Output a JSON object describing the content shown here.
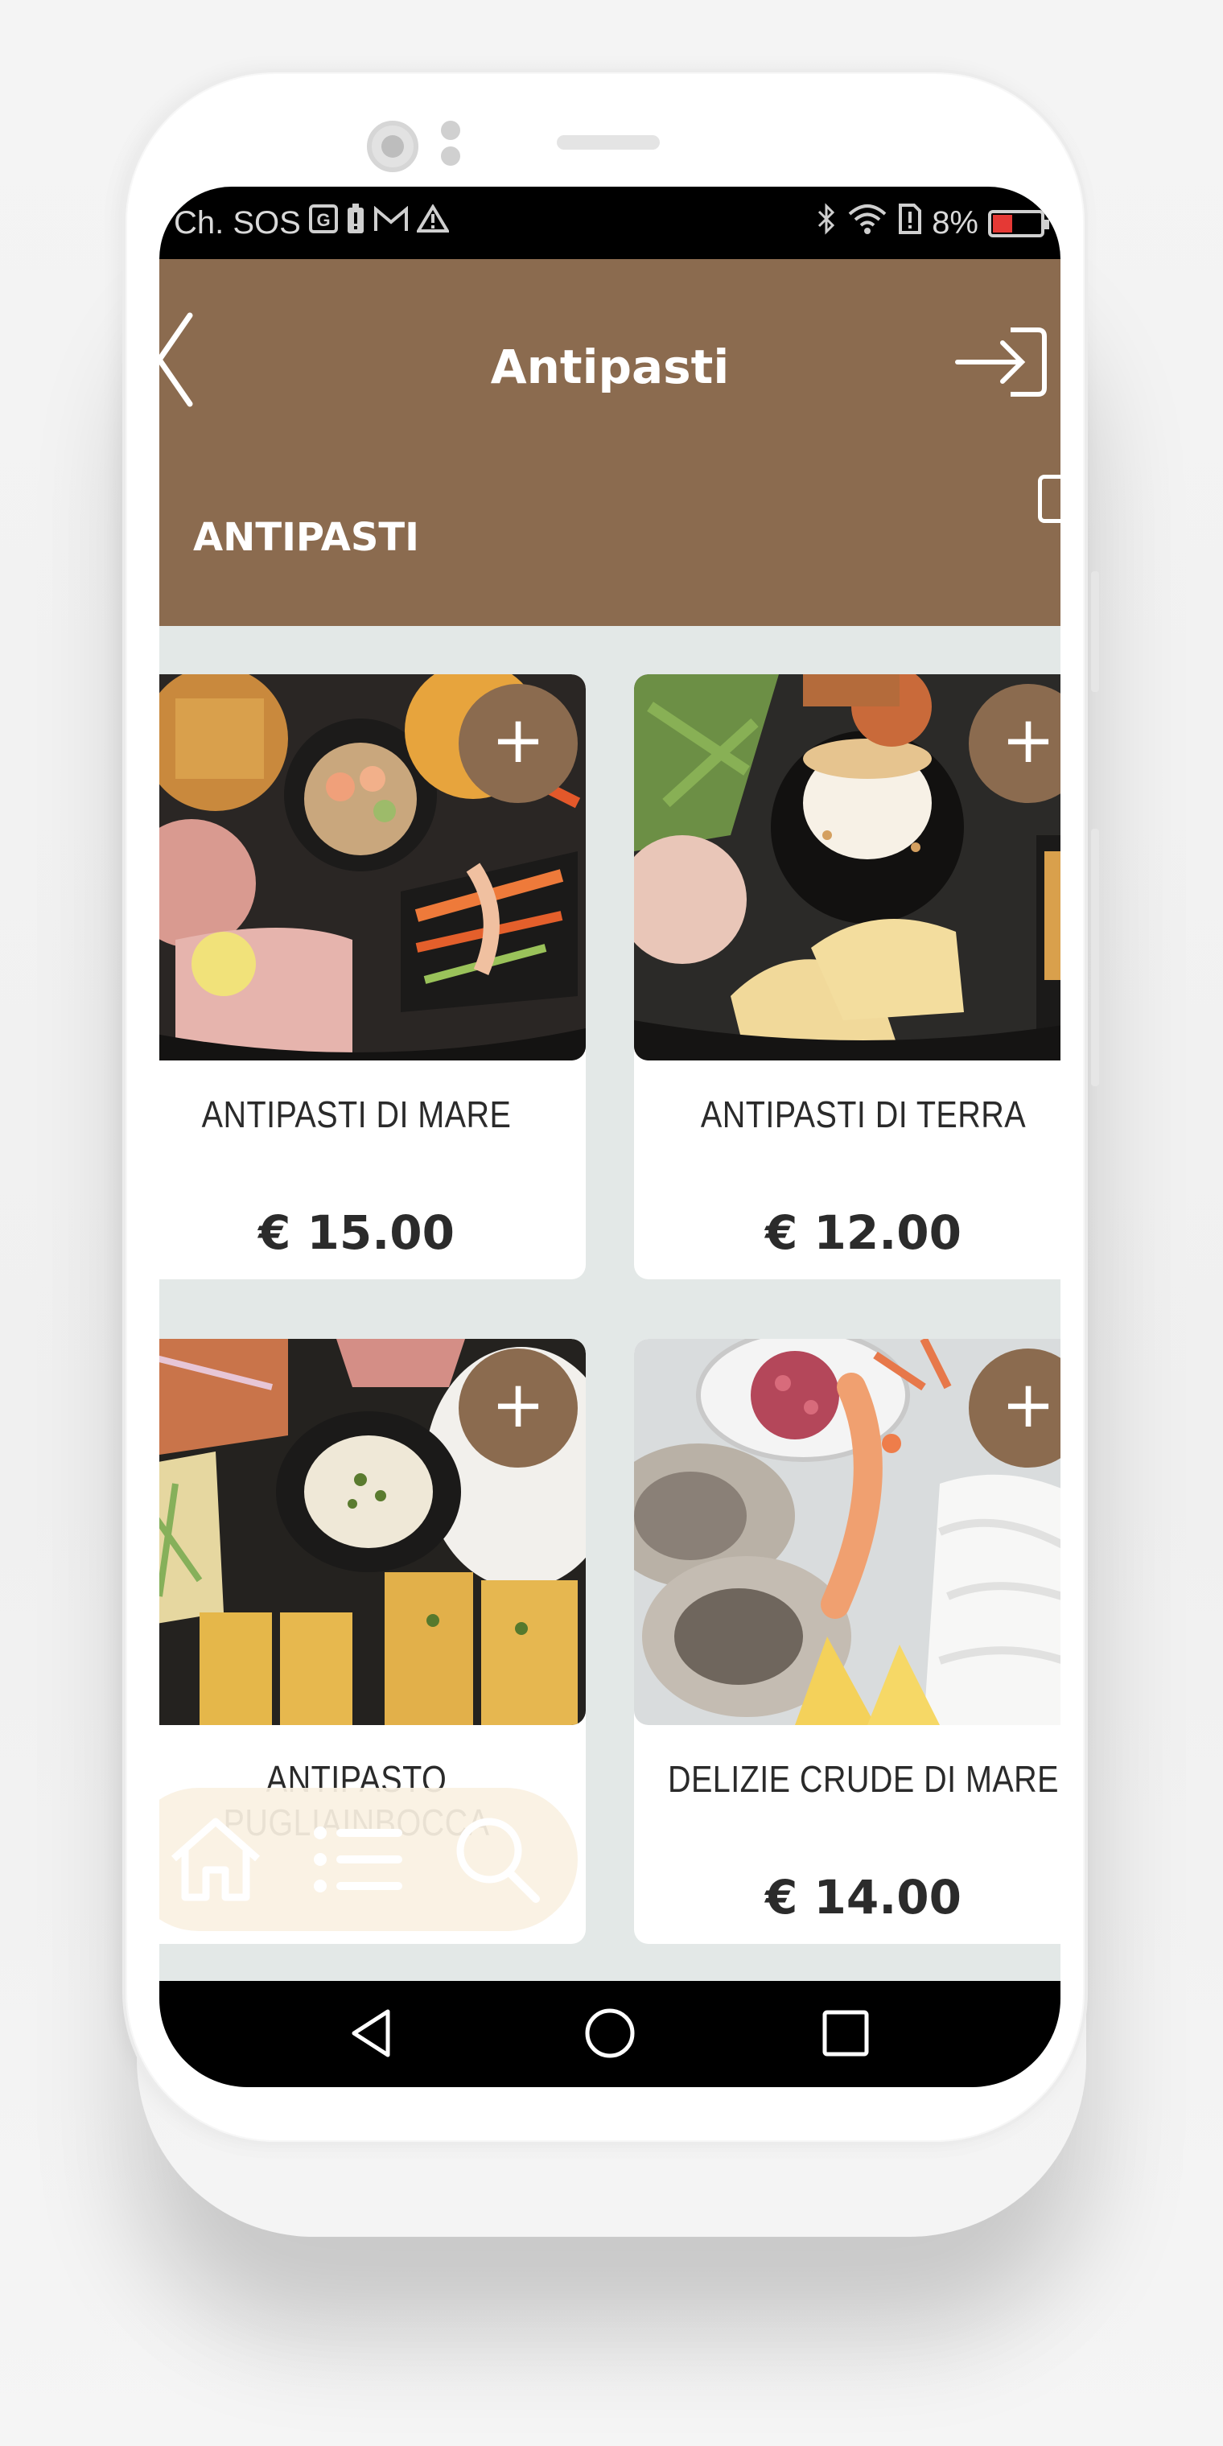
{
  "status_bar": {
    "left_text": "Ch. SOS",
    "battery_percent": "8%",
    "icons_left": [
      "google-icon",
      "battery-alert-icon",
      "gmail-icon",
      "warning-icon"
    ],
    "icons_right": [
      "bluetooth-icon",
      "wifi-icon",
      "sim-alert-icon",
      "battery-icon"
    ]
  },
  "app_bar": {
    "title": "Antipasti",
    "back_icon": "chevron-left-icon",
    "login_icon": "login-icon",
    "color": "#8b6b4f"
  },
  "tabs": [
    {
      "label": "ANTIPASTI",
      "active": true
    }
  ],
  "products": [
    {
      "name": "ANTIPASTI DI MARE",
      "price": "€ 15.00",
      "image": "seafood-platter"
    },
    {
      "name": "ANTIPASTI DI TERRA",
      "price": "€ 12.00",
      "image": "cold-cuts-platter"
    },
    {
      "name": "ANTIPASTO PUGLIAINBOCCA",
      "price": "",
      "image": "puglia-platter"
    },
    {
      "name": "DELIZIE CRUDE DI MARE",
      "price": "€ 14.00",
      "image": "raw-seafood-platter"
    }
  ],
  "add_button_label": "+",
  "bottom_nav": {
    "items": [
      "home-icon",
      "list-icon",
      "search-icon"
    ],
    "background": "#faf1e2"
  },
  "system_nav": [
    "back-triangle-icon",
    "home-circle-icon",
    "recents-square-icon"
  ]
}
